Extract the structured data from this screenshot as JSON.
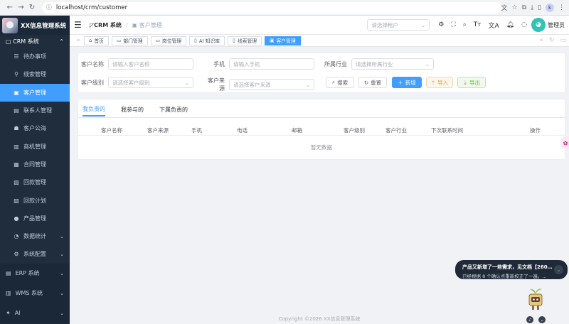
{
  "browser": {
    "url": "localhost/crm/customer"
  },
  "sidebar": {
    "brand": "XX信息管理系统",
    "group": "CRM 系统",
    "items": [
      {
        "icon": "☰",
        "label": "待办事项"
      },
      {
        "icon": "⚲",
        "label": "线索管理"
      },
      {
        "icon": "▣",
        "label": "客户管理"
      },
      {
        "icon": "▤",
        "label": "联系人管理"
      },
      {
        "icon": "☗",
        "label": "客户公海"
      },
      {
        "icon": "▥",
        "label": "商机管理"
      },
      {
        "icon": "▦",
        "label": "合同管理"
      },
      {
        "icon": "▧",
        "label": "回款管理"
      },
      {
        "icon": "▨",
        "label": "回款计划"
      },
      {
        "icon": "●",
        "label": "产品管理"
      },
      {
        "icon": "◔",
        "label": "数据统计"
      },
      {
        "icon": "⚙",
        "label": "系统配置"
      }
    ],
    "top_groups": [
      {
        "icon": "▤",
        "label": "ERP 系统"
      },
      {
        "icon": "▥",
        "label": "WMS 系统"
      },
      {
        "icon": "✦",
        "label": "AI"
      }
    ]
  },
  "header": {
    "home": "CRM 系统",
    "current": "客户管理",
    "tenant_placeholder": "请选择租户",
    "user": "管理员"
  },
  "tags": [
    {
      "icon": "⌂",
      "label": "首页"
    },
    {
      "icon": "▭",
      "label": "部门管理"
    },
    {
      "icon": "▭",
      "label": "岗位管理"
    },
    {
      "icon": "▯",
      "label": "AI 知识库"
    },
    {
      "icon": "▯",
      "label": "线索管理"
    },
    {
      "icon": "▣",
      "label": "客户管理"
    }
  ],
  "search": {
    "name_label": "客户名称",
    "name_ph": "请输入客户名称",
    "mobile_label": "手机",
    "mobile_ph": "请输入手机",
    "industry_label": "所属行业",
    "industry_ph": "请选择所属行业",
    "level_label": "客户级别",
    "level_ph": "请选择客户级别",
    "source_label": "客户来源",
    "source_ph": "请选择客户来源",
    "btn_search": "搜索",
    "btn_reset": "重置",
    "btn_add": "新增",
    "btn_import": "导入",
    "btn_export": "导出"
  },
  "list": {
    "tabs": [
      "我负责的",
      "我参与的",
      "下属负责的"
    ],
    "columns": [
      "客户名称",
      "客户来源",
      "手机",
      "电话",
      "邮箱",
      "客户级别",
      "客户行业",
      "下次联系时间",
      "操作"
    ],
    "empty": "暂无数据"
  },
  "footer": "Copyright ©2026 XX信息管理系统",
  "toast": {
    "title": "产品又新增了一些需求，见文档【260…",
    "body": "已经根据 8 个确认点重新校正了一遍。…"
  }
}
